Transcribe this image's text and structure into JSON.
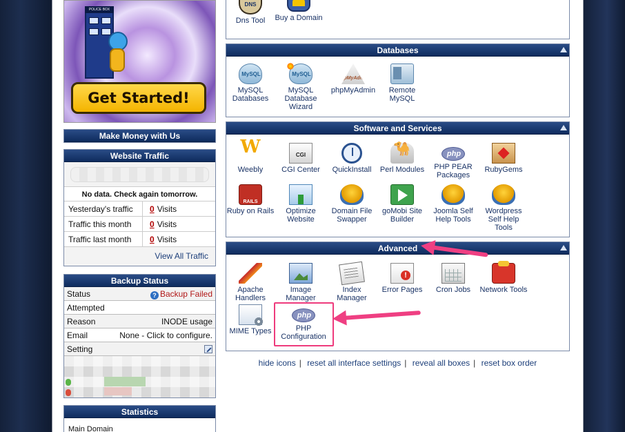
{
  "promo": {
    "button_label": "Get Started!",
    "sign": "POLICE BOX"
  },
  "left": {
    "make_money_title": "Make Money with Us",
    "traffic": {
      "title": "Website Traffic",
      "nodata": "No data. Check again tomorrow.",
      "rows": [
        {
          "label": "Yesterday's traffic",
          "count": "0",
          "unit": "Visits"
        },
        {
          "label": "Traffic this month",
          "count": "0",
          "unit": "Visits"
        },
        {
          "label": "Traffic last month",
          "count": "0",
          "unit": "Visits"
        }
      ],
      "view_all": "View All Traffic"
    },
    "backup": {
      "title": "Backup Status",
      "rows": [
        {
          "label": "Status",
          "value": "Backup Failed"
        },
        {
          "label": "Attempted",
          "value": ""
        },
        {
          "label": "Reason",
          "value": "INODE usage"
        },
        {
          "label": "Email",
          "value": "None - Click to configure."
        },
        {
          "label": "Setting",
          "value": ""
        }
      ]
    },
    "statistics": {
      "title": "Statistics",
      "main_domain": "Main Domain"
    }
  },
  "right": {
    "domains": {
      "items": [
        {
          "label": "Dns Tool"
        },
        {
          "label": "Buy a Domain"
        }
      ]
    },
    "databases": {
      "title": "Databases",
      "items": [
        {
          "label": "MySQL Databases"
        },
        {
          "label": "MySQL Database Wizard"
        },
        {
          "label": "phpMyAdmin"
        },
        {
          "label": "Remote MySQL"
        }
      ]
    },
    "software": {
      "title": "Software and Services",
      "items": [
        {
          "label": "Weebly"
        },
        {
          "label": "CGI Center"
        },
        {
          "label": "QuickInstall"
        },
        {
          "label": "Perl Modules"
        },
        {
          "label": "PHP PEAR Packages"
        },
        {
          "label": "RubyGems"
        },
        {
          "label": "Ruby on Rails"
        },
        {
          "label": "Optimize Website"
        },
        {
          "label": "Domain File Swapper"
        },
        {
          "label": "goMobi Site Builder"
        },
        {
          "label": "Joomla Self Help Tools"
        },
        {
          "label": "Wordpress Self Help Tools"
        }
      ]
    },
    "advanced": {
      "title": "Advanced",
      "items": [
        {
          "label": "Apache Handlers"
        },
        {
          "label": "Image Manager"
        },
        {
          "label": "Index Manager"
        },
        {
          "label": "Error Pages"
        },
        {
          "label": "Cron Jobs"
        },
        {
          "label": "Network Tools"
        },
        {
          "label": "MIME Types"
        },
        {
          "label": "PHP Configuration"
        }
      ]
    },
    "footer_links": {
      "hide_icons": "hide icons",
      "reset_settings": "reset all interface settings",
      "reveal_boxes": "reveal all boxes",
      "reset_order": "reset box order",
      "separator": "|"
    }
  },
  "colors": {
    "header_bar": "#0f2c5e",
    "highlight": "#ee3a7c",
    "failed": "#b11818"
  }
}
